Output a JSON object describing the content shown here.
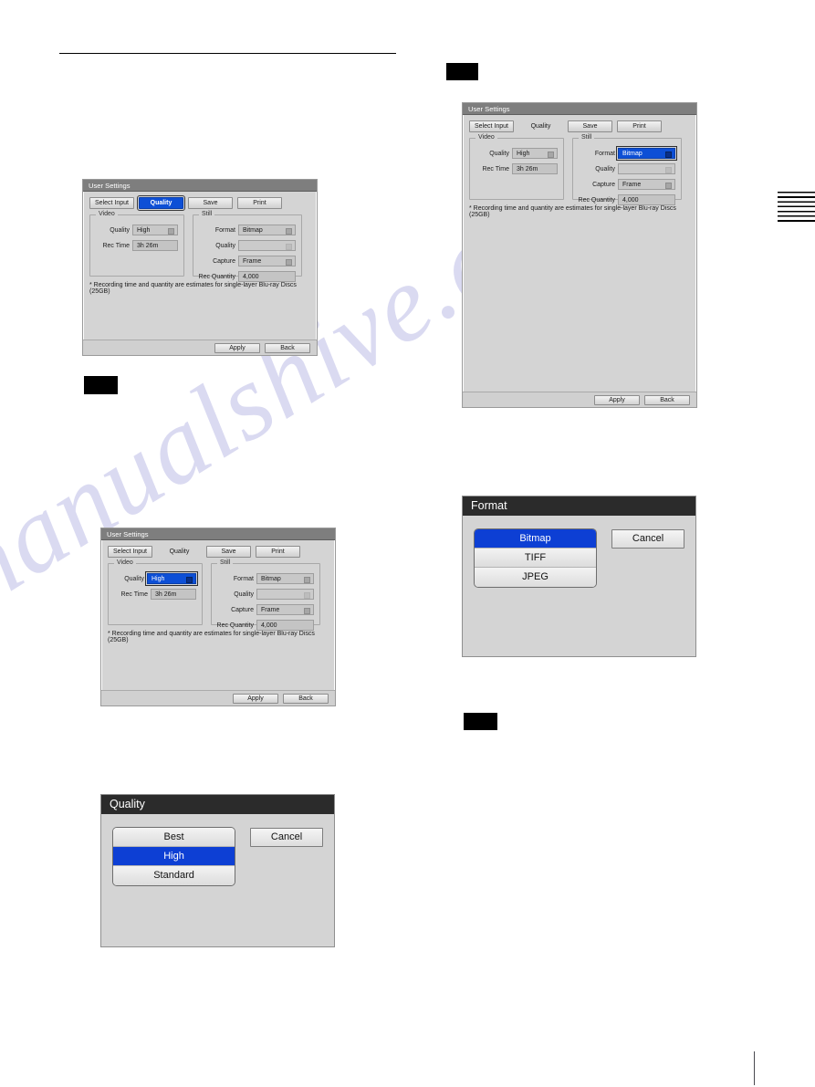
{
  "page": {
    "watermark_text": "manualshive.com",
    "accent_blue": "#0d4fd6",
    "dialog_bg": "#d4d4d4",
    "titlebar_gray": "#7e7e7e",
    "popup_titlebar": "#2b2b2b"
  },
  "user_settings": {
    "title": "User Settings",
    "tabs": [
      {
        "label": "Select Input"
      },
      {
        "label": "Quality"
      },
      {
        "label": "Save"
      },
      {
        "label": "Print"
      }
    ],
    "video_group": {
      "title": "Video",
      "quality_label": "Quality",
      "quality_value": "High",
      "rec_time_label": "Rec Time",
      "rec_time_value": "3h 26m"
    },
    "still_group": {
      "title": "Still",
      "format_label": "Format",
      "format_value": "Bitmap",
      "quality_label": "Quality",
      "quality_value": "",
      "capture_label": "Capture",
      "capture_value": "Frame",
      "rec_quantity_label": "Rec Quantity",
      "rec_quantity_value": "4,000"
    },
    "note": "* Recording time and quantity are estimates for single-layer Blu-ray Discs (25GB)",
    "apply_label": "Apply",
    "back_label": "Back"
  },
  "quality_popup": {
    "title": "Quality",
    "options": [
      {
        "label": "Best"
      },
      {
        "label": "High"
      },
      {
        "label": "Standard"
      }
    ],
    "selected": "High",
    "cancel_label": "Cancel"
  },
  "format_popup": {
    "title": "Format",
    "options": [
      {
        "label": "Bitmap"
      },
      {
        "label": "TIFF"
      },
      {
        "label": "JPEG"
      }
    ],
    "selected": "Bitmap",
    "cancel_label": "Cancel"
  }
}
